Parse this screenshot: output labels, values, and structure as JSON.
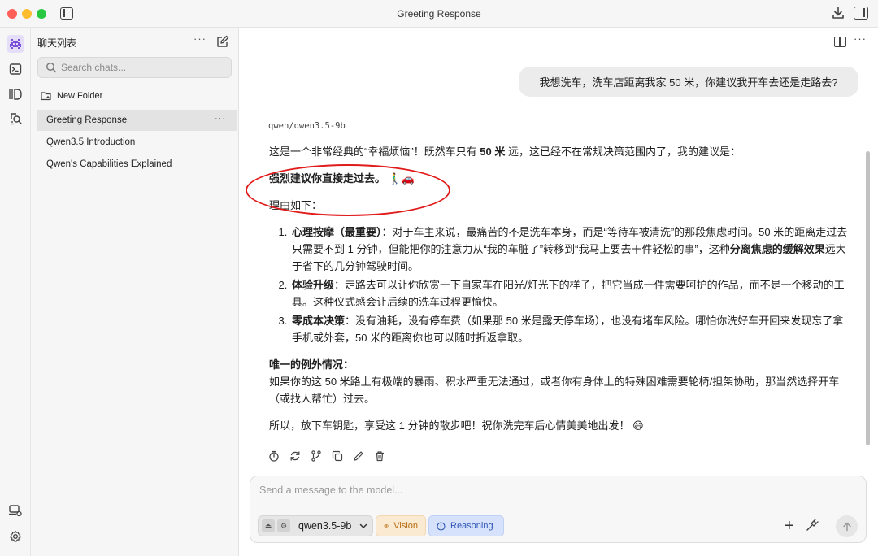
{
  "window": {
    "title": "Greeting Response"
  },
  "sidebar": {
    "header": "聊天列表",
    "more": "···",
    "search_placeholder": "Search chats...",
    "new_folder": "New Folder",
    "chats": [
      {
        "title": "Greeting Response",
        "active": true
      },
      {
        "title": "Qwen3.5 Introduction",
        "active": false
      },
      {
        "title": "Qwen's Capabilities Explained",
        "active": false
      }
    ]
  },
  "main": {
    "more": "···",
    "user_message": "我想洗车，洗车店距离我家 50 米，你建议我开车去还是走路去?",
    "model_tag": "qwen/qwen3.5-9b",
    "answer": {
      "intro_a": "这是一个非常经典的“幸福烦恼”！既然车只有 ",
      "intro_bold": "50 米",
      "intro_b": " 远，这已经不在常规决策范围内了，我的建议是：",
      "recommend": "强烈建议你直接走过去。",
      "recommend_emoji": "🚶‍♂️🚗",
      "reasons_heading": "理由如下：",
      "reasons": [
        {
          "title": "心理按摩（最重要）",
          "text_a": "：对于车主来说，最痛苦的不是洗车本身，而是“等待车被清洗”的那段焦虑时间。50 米的距离走过去只需要不到 1 分钟，但能把你的注意力从“我的车脏了”转移到“我马上要去干件轻松的事”，这种",
          "bold_mid": "分离焦虑的缓解效果",
          "text_b": "远大于省下的几分钟驾驶时间。"
        },
        {
          "title": "体验升级",
          "text_a": "：走路去可以让你欣赏一下自家车在阳光/灯光下的样子，把它当成一件需要呵护的作品，而不是一个移动的工具。这种仪式感会让后续的洗车过程更愉快。",
          "bold_mid": "",
          "text_b": ""
        },
        {
          "title": "零成本决策",
          "text_a": "：没有油耗，没有停车费（如果那 50 米是露天停车场），也没有堵车风险。哪怕你洗好车开回来发现忘了拿手机或外套，50 米的距离你也可以随时折返拿取。",
          "bold_mid": "",
          "text_b": ""
        }
      ],
      "exception_heading": "唯一的例外情况：",
      "exception_text": "如果你的这 50 米路上有极端的暴雨、积水严重无法通过，或者你有身体上的特殊困难需要轮椅/担架协助，那当然选择开车（或找人帮忙）过去。",
      "closing": "所以，放下车钥匙，享受这 1 分钟的散步吧！祝你洗完车后心情美美地出发！",
      "closing_emoji": "😄"
    }
  },
  "composer": {
    "placeholder": "Send a message to the model...",
    "model": "qwen3.5-9b",
    "vision_label": "Vision",
    "reasoning_label": "Reasoning",
    "plus": "+"
  },
  "icons": {
    "rail": [
      "space-invader-icon",
      "terminal-icon",
      "model-library-icon",
      "search-doc-icon",
      "developer-icon",
      "settings-gear-icon"
    ],
    "actions": [
      "timer-icon",
      "regenerate-icon",
      "branch-icon",
      "copy-icon",
      "edit-icon",
      "delete-icon"
    ]
  },
  "colors": {
    "accent_purple": "#7b4fd6",
    "highlight_red": "#e11a1a",
    "vision_orange": "#b66d12",
    "reasoning_blue": "#2f55b6"
  }
}
